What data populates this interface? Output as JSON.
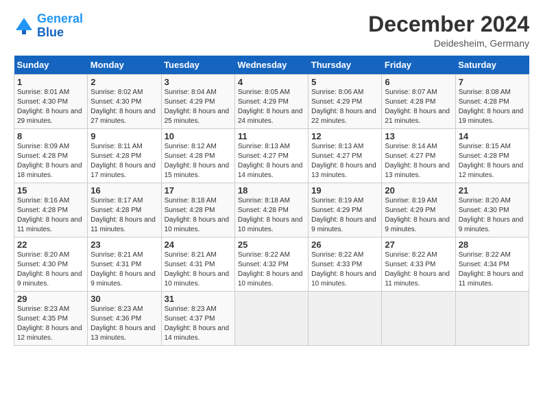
{
  "header": {
    "logo_line1": "General",
    "logo_line2": "Blue",
    "month_title": "December 2024",
    "location": "Deidesheim, Germany"
  },
  "weekdays": [
    "Sunday",
    "Monday",
    "Tuesday",
    "Wednesday",
    "Thursday",
    "Friday",
    "Saturday"
  ],
  "weeks": [
    [
      {
        "day": "1",
        "sunrise": "8:01 AM",
        "sunset": "4:30 PM",
        "daylight": "8 hours and 29 minutes."
      },
      {
        "day": "2",
        "sunrise": "8:02 AM",
        "sunset": "4:30 PM",
        "daylight": "8 hours and 27 minutes."
      },
      {
        "day": "3",
        "sunrise": "8:04 AM",
        "sunset": "4:29 PM",
        "daylight": "8 hours and 25 minutes."
      },
      {
        "day": "4",
        "sunrise": "8:05 AM",
        "sunset": "4:29 PM",
        "daylight": "8 hours and 24 minutes."
      },
      {
        "day": "5",
        "sunrise": "8:06 AM",
        "sunset": "4:29 PM",
        "daylight": "8 hours and 22 minutes."
      },
      {
        "day": "6",
        "sunrise": "8:07 AM",
        "sunset": "4:28 PM",
        "daylight": "8 hours and 21 minutes."
      },
      {
        "day": "7",
        "sunrise": "8:08 AM",
        "sunset": "4:28 PM",
        "daylight": "8 hours and 19 minutes."
      }
    ],
    [
      {
        "day": "8",
        "sunrise": "8:09 AM",
        "sunset": "4:28 PM",
        "daylight": "8 hours and 18 minutes."
      },
      {
        "day": "9",
        "sunrise": "8:11 AM",
        "sunset": "4:28 PM",
        "daylight": "8 hours and 17 minutes."
      },
      {
        "day": "10",
        "sunrise": "8:12 AM",
        "sunset": "4:28 PM",
        "daylight": "8 hours and 15 minutes."
      },
      {
        "day": "11",
        "sunrise": "8:13 AM",
        "sunset": "4:27 PM",
        "daylight": "8 hours and 14 minutes."
      },
      {
        "day": "12",
        "sunrise": "8:13 AM",
        "sunset": "4:27 PM",
        "daylight": "8 hours and 13 minutes."
      },
      {
        "day": "13",
        "sunrise": "8:14 AM",
        "sunset": "4:27 PM",
        "daylight": "8 hours and 13 minutes."
      },
      {
        "day": "14",
        "sunrise": "8:15 AM",
        "sunset": "4:28 PM",
        "daylight": "8 hours and 12 minutes."
      }
    ],
    [
      {
        "day": "15",
        "sunrise": "8:16 AM",
        "sunset": "4:28 PM",
        "daylight": "8 hours and 11 minutes."
      },
      {
        "day": "16",
        "sunrise": "8:17 AM",
        "sunset": "4:28 PM",
        "daylight": "8 hours and 11 minutes."
      },
      {
        "day": "17",
        "sunrise": "8:18 AM",
        "sunset": "4:28 PM",
        "daylight": "8 hours and 10 minutes."
      },
      {
        "day": "18",
        "sunrise": "8:18 AM",
        "sunset": "4:28 PM",
        "daylight": "8 hours and 10 minutes."
      },
      {
        "day": "19",
        "sunrise": "8:19 AM",
        "sunset": "4:29 PM",
        "daylight": "8 hours and 9 minutes."
      },
      {
        "day": "20",
        "sunrise": "8:19 AM",
        "sunset": "4:29 PM",
        "daylight": "8 hours and 9 minutes."
      },
      {
        "day": "21",
        "sunrise": "8:20 AM",
        "sunset": "4:30 PM",
        "daylight": "8 hours and 9 minutes."
      }
    ],
    [
      {
        "day": "22",
        "sunrise": "8:20 AM",
        "sunset": "4:30 PM",
        "daylight": "8 hours and 9 minutes."
      },
      {
        "day": "23",
        "sunrise": "8:21 AM",
        "sunset": "4:31 PM",
        "daylight": "8 hours and 9 minutes."
      },
      {
        "day": "24",
        "sunrise": "8:21 AM",
        "sunset": "4:31 PM",
        "daylight": "8 hours and 10 minutes."
      },
      {
        "day": "25",
        "sunrise": "8:22 AM",
        "sunset": "4:32 PM",
        "daylight": "8 hours and 10 minutes."
      },
      {
        "day": "26",
        "sunrise": "8:22 AM",
        "sunset": "4:33 PM",
        "daylight": "8 hours and 10 minutes."
      },
      {
        "day": "27",
        "sunrise": "8:22 AM",
        "sunset": "4:33 PM",
        "daylight": "8 hours and 11 minutes."
      },
      {
        "day": "28",
        "sunrise": "8:22 AM",
        "sunset": "4:34 PM",
        "daylight": "8 hours and 11 minutes."
      }
    ],
    [
      {
        "day": "29",
        "sunrise": "8:23 AM",
        "sunset": "4:35 PM",
        "daylight": "8 hours and 12 minutes."
      },
      {
        "day": "30",
        "sunrise": "8:23 AM",
        "sunset": "4:36 PM",
        "daylight": "8 hours and 13 minutes."
      },
      {
        "day": "31",
        "sunrise": "8:23 AM",
        "sunset": "4:37 PM",
        "daylight": "8 hours and 14 minutes."
      },
      null,
      null,
      null,
      null
    ]
  ]
}
